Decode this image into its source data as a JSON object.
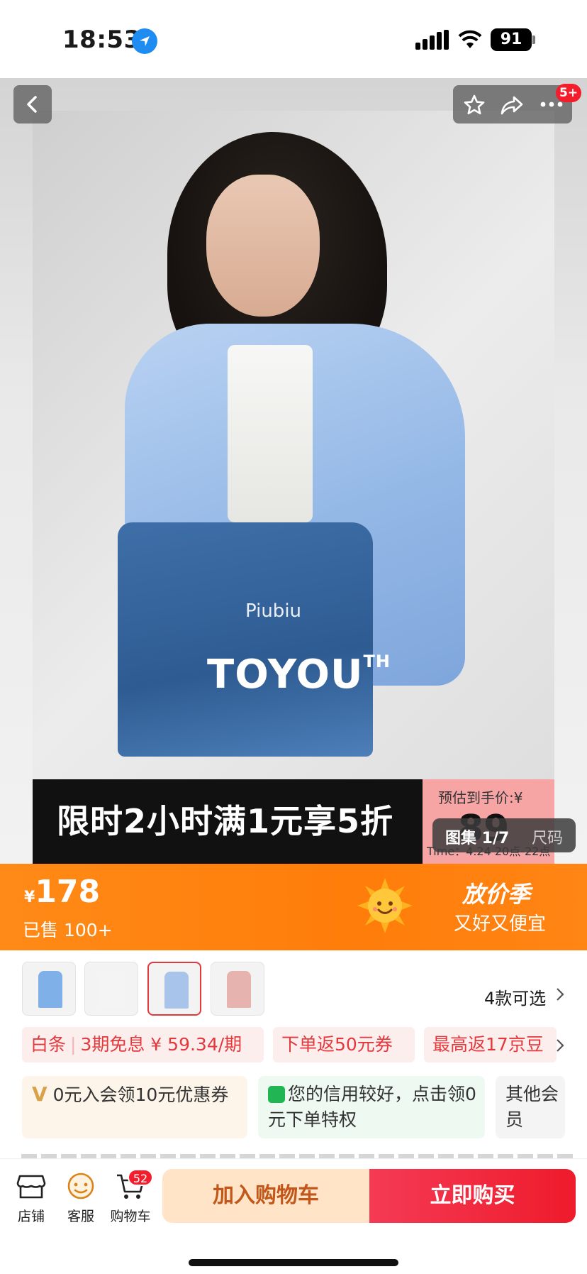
{
  "status_bar": {
    "time": "18:53",
    "battery": "91"
  },
  "top_nav": {
    "notification_badge": "5+"
  },
  "hero": {
    "watermark_small": "Piubiu",
    "watermark_brand": "TOYOU",
    "watermark_brand_sup": "TH",
    "promo_text": "限时2小时满1元享5折",
    "estimate_label": "预估到手价:¥",
    "estimate_price": "89",
    "estimate_time": "Time：4.24 20点-22点",
    "gallery_label": "图集 1/7",
    "size_label": "尺码"
  },
  "price_bar": {
    "currency": "¥",
    "price": "178",
    "sold": "已售 100+",
    "season_title": "放价季",
    "season_sub": "又好又便宜"
  },
  "variants": {
    "count_label": "4款可选",
    "thumb_colors": [
      "#7fb0e8",
      "#f4f4f4",
      "#a8c4ea",
      "#e7b3ae"
    ]
  },
  "coupons": [
    {
      "label": "白条",
      "detail": "3期免息 ¥ 59.34/期"
    },
    {
      "label": "下单返50元券"
    },
    {
      "label": "最高返17京豆"
    }
  ],
  "cards": {
    "member": "0元入会领10元优惠券",
    "credit": "您的信用较好，点击领0元下单特权",
    "other": "其他会员"
  },
  "bottom_bar": {
    "shop": "店铺",
    "service": "客服",
    "cart": "购物车",
    "cart_badge": "52",
    "add_to_cart": "加入购物车",
    "buy_now": "立即购买"
  }
}
